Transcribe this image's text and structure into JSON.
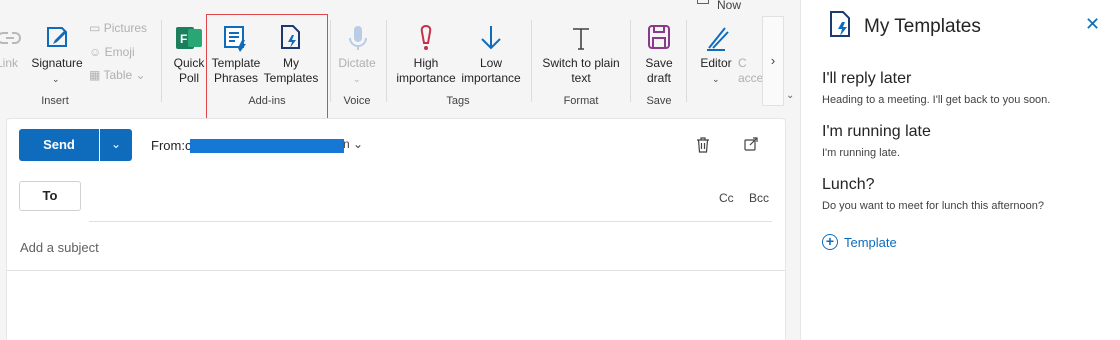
{
  "ribbon": {
    "now": "Now",
    "link": "Link",
    "signature": "Signature",
    "pictures": "Pictures",
    "emoji": "Emoji",
    "table": "Table",
    "quick_poll_1": "Quick",
    "quick_poll_2": "Poll",
    "template_phrases_1": "Template",
    "template_phrases_2": "Phrases",
    "my_templates_1": "My",
    "my_templates_2": "Templates",
    "dictate": "Dictate",
    "high_1": "High",
    "high_2": "importance",
    "low_1": "Low",
    "low_2": "importance",
    "switch_1": "Switch to plain",
    "switch_2": "text",
    "save_1": "Save",
    "save_2": "draft",
    "editor": "Editor",
    "access_1": "C",
    "access_2": "acce",
    "groups": {
      "insert": "Insert",
      "addins": "Add-ins",
      "voice": "Voice",
      "tags": "Tags",
      "format": "Format",
      "save": "Save"
    }
  },
  "compose": {
    "send": "Send",
    "from_label": "From:",
    "from_visible_start": "c",
    "from_visible_end": "n",
    "to": "To",
    "cc": "Cc",
    "bcc": "Bcc",
    "subject_placeholder": "Add a subject"
  },
  "pane": {
    "title": "My Templates",
    "templates": [
      {
        "title": "I'll reply later",
        "body": "Heading to a meeting. I'll get back to you soon."
      },
      {
        "title": "I'm running late",
        "body": "I'm running late."
      },
      {
        "title": "Lunch?",
        "body": "Do you want to meet for lunch this afternoon?"
      }
    ],
    "add_template": "Template"
  },
  "colors": {
    "accent": "#0f6cbd",
    "highlight": "#e0474c",
    "poll_green": "#1b7f5c",
    "importance_red": "#c4314b",
    "save_purple": "#8a3a8a"
  }
}
